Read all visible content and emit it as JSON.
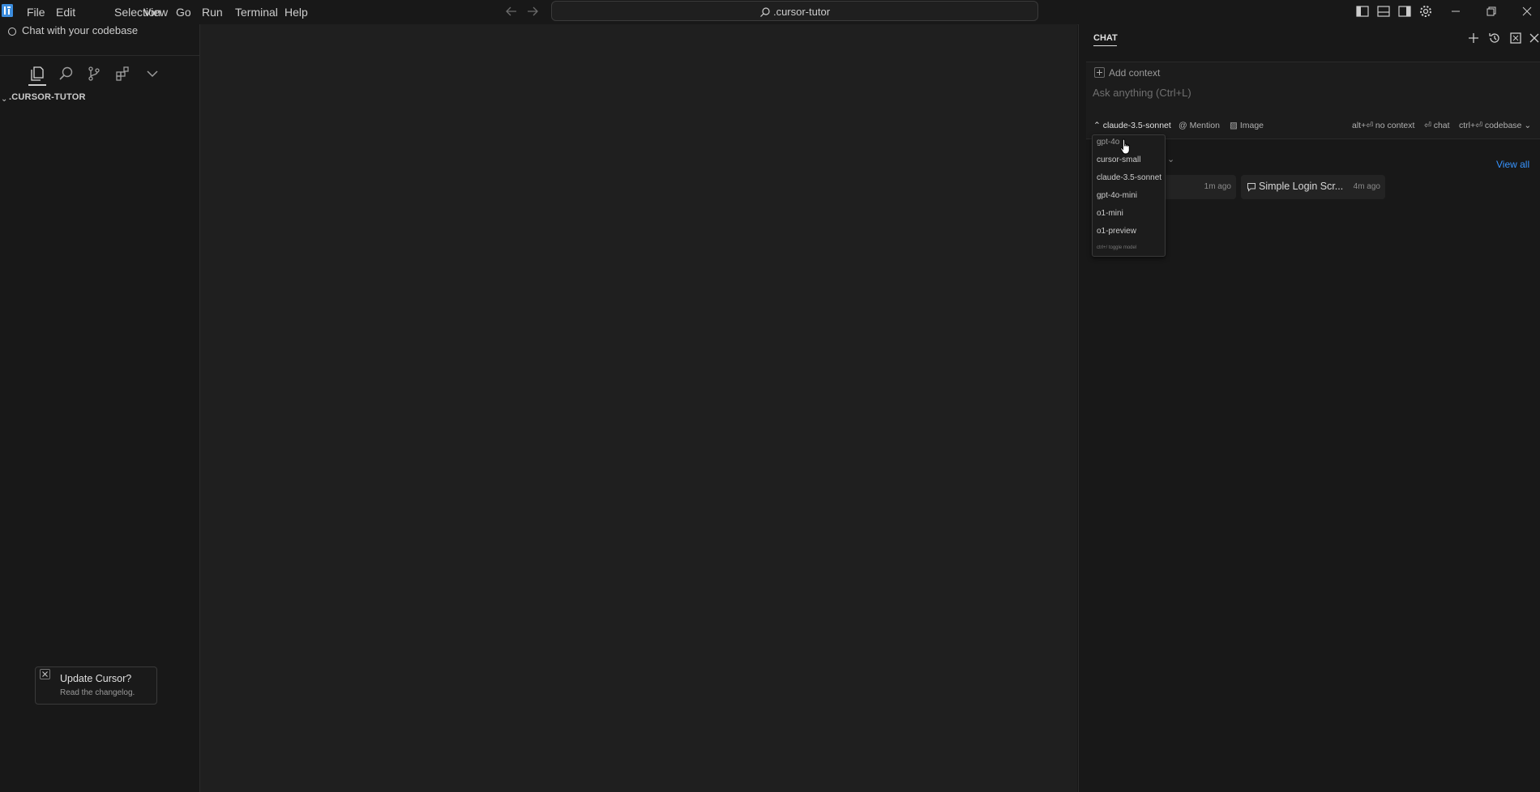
{
  "app": {
    "logo_icon": "cursor-logo-icon"
  },
  "menu": [
    "File",
    "Edit",
    "Selection",
    "View",
    "Go",
    "Run",
    "Terminal",
    "Help"
  ],
  "search": {
    "text": ".cursor-tutor"
  },
  "sidebar": {
    "hint": "Chat with your codebase",
    "explorer_title": ".CURSOR-TUTOR"
  },
  "chat": {
    "tab_title": "CHAT",
    "add_context": "Add context",
    "placeholder": "Ask anything (Ctrl+L)",
    "model": "claude-3.5-sonnet",
    "mention": "Mention",
    "image": "Image",
    "shortcut_no_context": "alt+⏎ no context",
    "shortcut_chat": "⏎ chat",
    "shortcut_codebase": "ctrl+⏎ codebase",
    "view_all": "View all",
    "recent": [
      {
        "title": "",
        "time": "1m ago"
      },
      {
        "title": "Simple Login Scr...",
        "time": "4m ago"
      }
    ]
  },
  "model_dropdown": {
    "options": [
      "gpt-4o",
      "cursor-small",
      "claude-3.5-sonnet",
      "gpt-4o-mini",
      "o1-mini",
      "o1-preview"
    ],
    "footer": "ctrl+/ toggle model"
  },
  "toast": {
    "title": "Update Cursor?",
    "body": "Read the changelog."
  },
  "colors": {
    "accent": "#3794ff",
    "bg": "#181818",
    "editor_bg": "#1f1f1f"
  }
}
